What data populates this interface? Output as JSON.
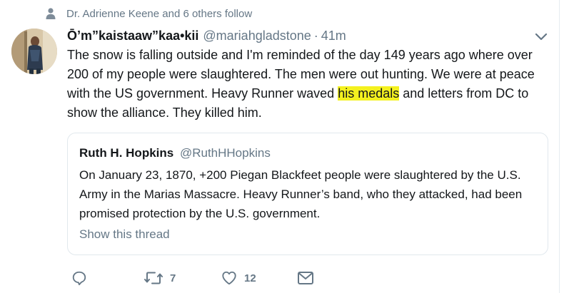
{
  "social_context": {
    "icon": "person-icon",
    "text": "Dr. Adrienne Keene and 6 others follow"
  },
  "tweet": {
    "fullname": "Ō’m”kaistaaw”kaa•kii",
    "handle": "@mariahgladstone",
    "separator": "·",
    "time": "41m",
    "text_before": "The snow is falling outside and I'm reminded of the day 149 years ago where over 200 of my people were slaughtered. The men were out hunting. We were at peace with the US government. Heavy Runner waved ",
    "text_highlight": "his medals",
    "text_after": " and letters from DC to show the alliance. They killed him.",
    "highlight_color": "#f4f11f"
  },
  "quote": {
    "fullname": "Ruth H. Hopkins",
    "handle": "@RuthHHopkins",
    "text": "On January 23, 1870, +200 Piegan Blackfeet people were slaughtered by the U.S. Army in the Marias Massacre. Heavy Runner’s band, who they attacked, had been promised protection by the U.S. government.",
    "show_thread": "Show this thread"
  },
  "actions": {
    "reply": {
      "icon": "reply-icon",
      "count": ""
    },
    "retweet": {
      "icon": "retweet-icon",
      "count": "7"
    },
    "like": {
      "icon": "heart-icon",
      "count": "12"
    },
    "dm": {
      "icon": "mail-icon",
      "count": ""
    }
  },
  "colors": {
    "text": "#14171a",
    "secondary": "#657786",
    "border": "#e1e8ed"
  }
}
